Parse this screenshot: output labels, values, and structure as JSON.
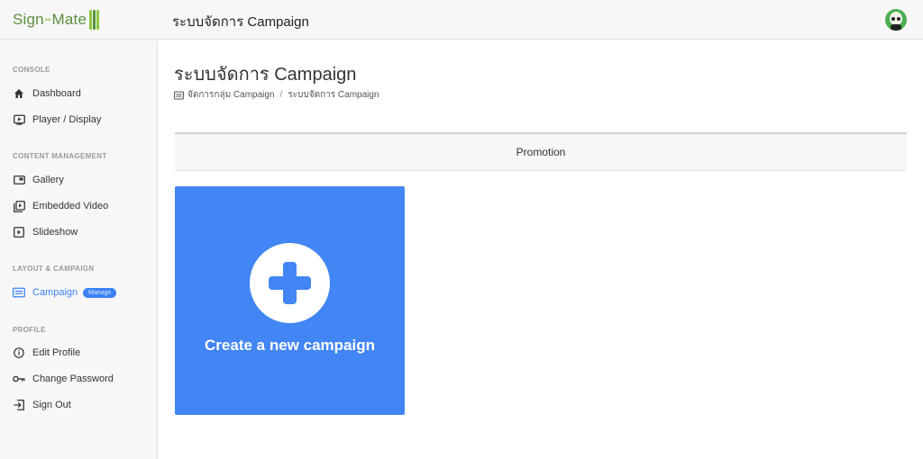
{
  "app": {
    "logo_sign": "Sign",
    "logo_mid": "••",
    "logo_mate": "Mate",
    "title": "ระบบจัดการ Campaign"
  },
  "sidebar": {
    "sections": [
      {
        "label": "CONSOLE",
        "items": [
          {
            "label": "Dashboard",
            "icon": "home-icon"
          },
          {
            "label": "Player / Display",
            "icon": "display-play-icon"
          }
        ]
      },
      {
        "label": "CONTENT MANAGEMENT",
        "items": [
          {
            "label": "Gallery",
            "icon": "gallery-icon"
          },
          {
            "label": "Embedded Video",
            "icon": "video-library-icon"
          },
          {
            "label": "Slideshow",
            "icon": "slideshow-icon"
          }
        ]
      },
      {
        "label": "LAYOUT & CAMPAIGN",
        "items": [
          {
            "label": "Campaign",
            "icon": "campaign-icon",
            "badge": "Manage",
            "active": true
          }
        ]
      },
      {
        "label": "PROFILE",
        "items": [
          {
            "label": "Edit Profile",
            "icon": "info-icon"
          },
          {
            "label": "Change Password",
            "icon": "key-icon"
          },
          {
            "label": "Sign Out",
            "icon": "sign-out-icon"
          }
        ]
      }
    ]
  },
  "main": {
    "title": "ระบบจัดการ Campaign",
    "breadcrumb": {
      "parent": "จัดการกลุ่ม Campaign",
      "separator": "/",
      "current": "ระบบจัดการ Campaign"
    },
    "tab": "Promotion",
    "create_card": {
      "label": "Create a new campaign"
    }
  },
  "colors": {
    "accent": "#4285f4",
    "active_nav": "#3b82f6",
    "logo_green": "#5a8f3c",
    "avatar_bg": "#4caf50"
  }
}
